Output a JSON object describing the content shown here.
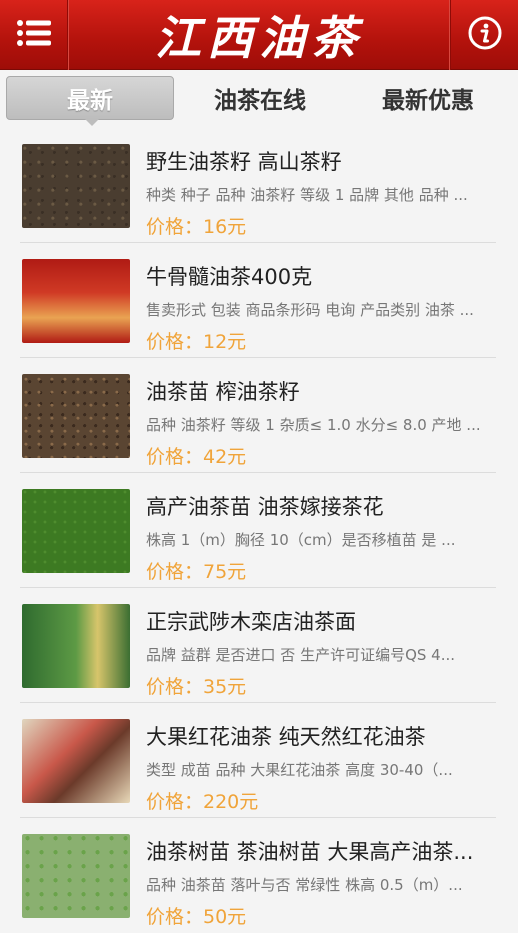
{
  "header": {
    "title": "江西油茶",
    "menu_icon": "menu-icon",
    "info_icon": "info-icon"
  },
  "tabs": [
    {
      "label": "最新",
      "active": true
    },
    {
      "label": "油茶在线",
      "active": false
    },
    {
      "label": "最新优惠",
      "active": false
    }
  ],
  "items": [
    {
      "name": "野生油茶籽  高山茶籽",
      "desc": "种类 种子 品种 油茶籽 等级 1 品牌 其他 品种 ...",
      "price": "价格：16元"
    },
    {
      "name": "牛骨髓油茶400克",
      "desc": "售卖形式 包装 商品条形码 电询 产品类别 油茶 ...",
      "price": "价格：12元"
    },
    {
      "name": "油茶苗 榨油茶籽",
      "desc": "品种 油茶籽 等级 1 杂质≤ 1.0 水分≤ 8.0 产地 ...",
      "price": "价格：42元"
    },
    {
      "name": "高产油茶苗 油茶嫁接茶花",
      "desc": "株高 1（m）胸径 10（cm）是否移植苗 是 ...",
      "price": "价格：75元"
    },
    {
      "name": "正宗武陟木栾店油茶面",
      "desc": "品牌 益群 是否进口 否 生产许可证编号QS 4...",
      "price": "价格：35元"
    },
    {
      "name": "大果红花油茶 纯天然红花油茶",
      "desc": "类型 成苗 品种 大果红花油茶 高度 30-40（...",
      "price": "价格：220元"
    },
    {
      "name": "油茶树苗 茶油树苗 大果高产油茶...",
      "desc": "品种 油茶苗 落叶与否 常绿性 株高 0.5（m）...",
      "price": "价格：50元"
    }
  ]
}
